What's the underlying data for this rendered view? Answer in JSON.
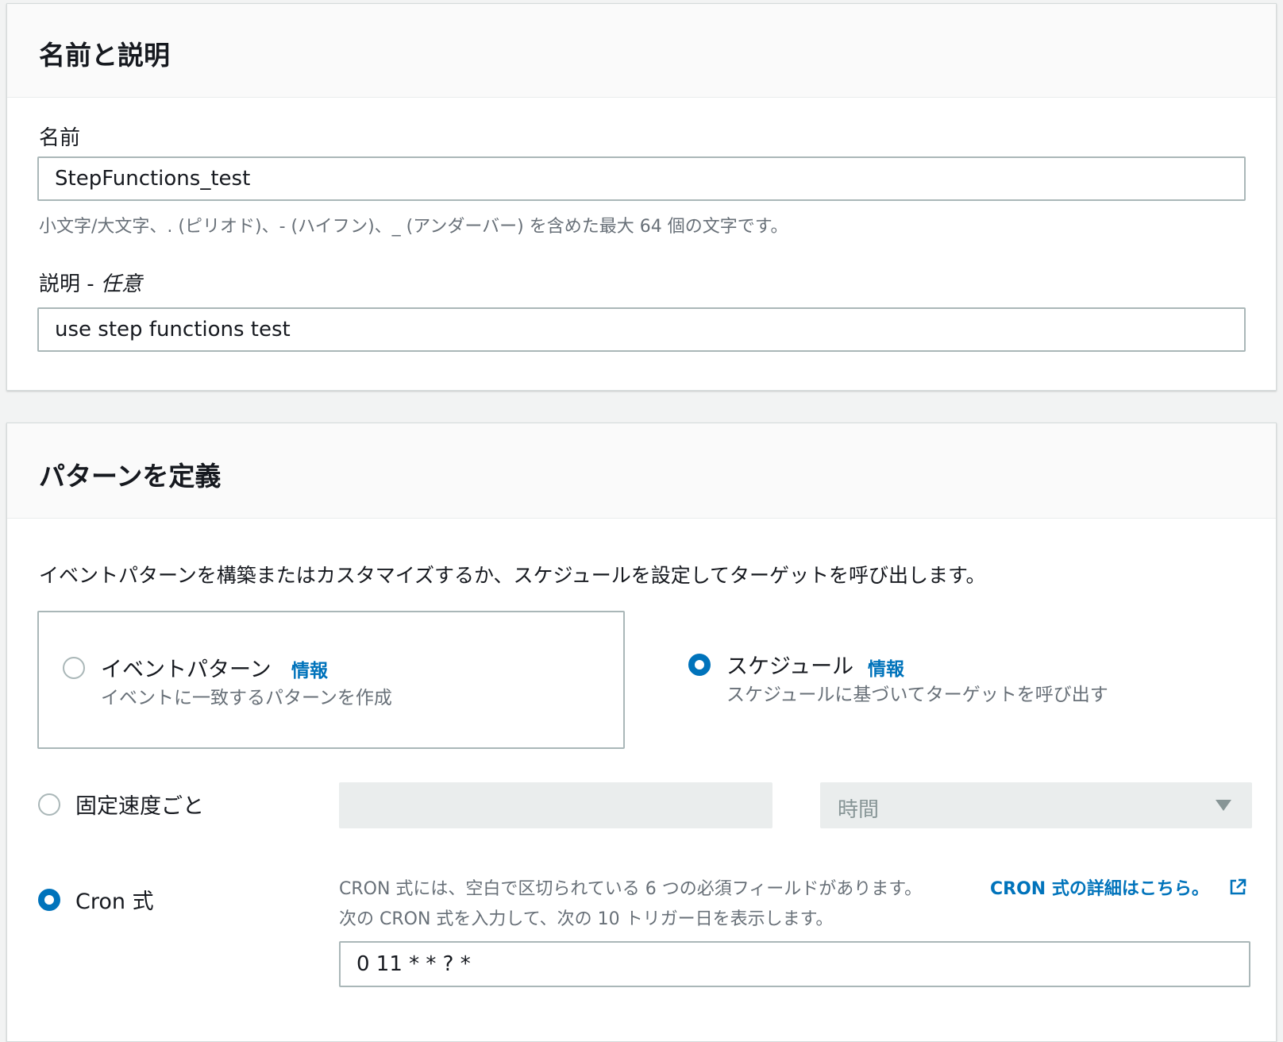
{
  "name_section": {
    "title": "名前と説明",
    "name_label": "名前",
    "name_value": "StepFunctions_test",
    "name_hint": "小文字/大文字、. (ピリオド)、- (ハイフン)、_ (アンダーバー) を含めた最大 64 個の文字です。",
    "description_label": "説明 - ",
    "description_optional": "任意",
    "description_value": "use step functions test"
  },
  "pattern_section": {
    "title": "パターンを定義",
    "intro": "イベントパターンを構築またはカスタマイズするか、スケジュールを設定してターゲットを呼び出します。",
    "event_pattern": {
      "title": "イベントパターン",
      "info": "情報",
      "description": "イベントに一致するパターンを作成",
      "selected": false
    },
    "schedule": {
      "title": "スケジュール",
      "info": "情報",
      "description": "スケジュールに基づいてターゲットを呼び出す",
      "selected": true
    },
    "fixed_rate": {
      "label": "固定速度ごと",
      "selected": false,
      "value": "",
      "unit": "時間"
    },
    "cron": {
      "label": "Cron 式",
      "selected": true,
      "help_text": "CRON 式には、空白で区切られている 6 つの必須フィールドがあります。",
      "help_link": "CRON 式の詳細はこちら。",
      "instruction": "次の CRON 式を入力して、次の 10 トリガー日を表示します。",
      "value": "0 11 * * ? *"
    }
  },
  "colors": {
    "accent": "#0073bb",
    "border": "#aab7b8",
    "muted_text": "#687078",
    "header_bg": "#fafafa",
    "page_bg": "#f2f3f3"
  },
  "icons": {
    "external_link": "external-link-icon",
    "dropdown": "caret-down-icon"
  }
}
